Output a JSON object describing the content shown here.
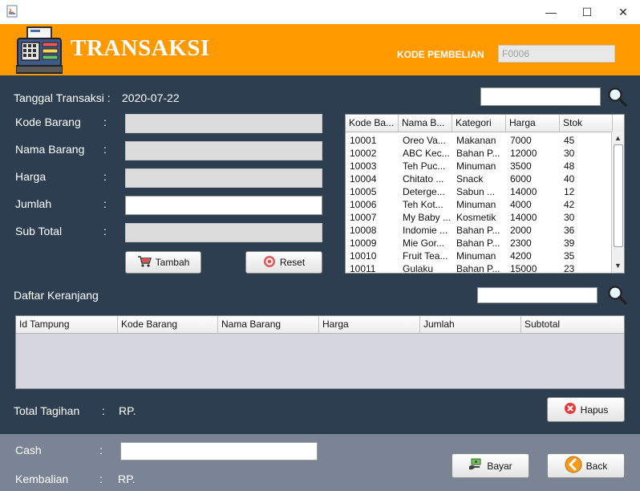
{
  "window": {
    "minimize": "—",
    "maximize": "☐",
    "close": "✕"
  },
  "header": {
    "title": "TRANSAKSI",
    "kode_label": "KODE PEMBELIAN",
    "kode_value": "F0006"
  },
  "form": {
    "tanggal_label": "Tanggal Transaksi :",
    "tanggal_value": "2020-07-22",
    "kode_label": "Kode Barang",
    "nama_label": "Nama Barang",
    "harga_label": "Harga",
    "jumlah_label": "Jumlah",
    "subtotal_label": "Sub Total",
    "colon": ":",
    "tambah": "Tambah",
    "reset": "Reset"
  },
  "barang_table": {
    "headers": [
      "Kode Ba...",
      "Nama B...",
      "Kategori",
      "Harga",
      "Stok"
    ],
    "rows": [
      [
        "10001",
        "Oreo Va...",
        "Makanan",
        "7000",
        "45"
      ],
      [
        "10002",
        "ABC Kec...",
        "Bahan P...",
        "12000",
        "30"
      ],
      [
        "10003",
        "Teh Puc...",
        "Minuman",
        "3500",
        "48"
      ],
      [
        "10004",
        "Chitato ...",
        "Snack",
        "6000",
        "40"
      ],
      [
        "10005",
        "Deterge...",
        "Sabun ...",
        "14000",
        "12"
      ],
      [
        "10006",
        "Teh Kot...",
        "Minuman",
        "4000",
        "42"
      ],
      [
        "10007",
        "My Baby ...",
        "Kosmetik",
        "14000",
        "30"
      ],
      [
        "10008",
        "Indomie ...",
        "Bahan P...",
        "2000",
        "36"
      ],
      [
        "10009",
        "Mie Gor...",
        "Bahan P...",
        "2300",
        "39"
      ],
      [
        "10010",
        "Fruit Tea...",
        "Minuman",
        "4200",
        "35"
      ],
      [
        "10011",
        "Gulaku",
        "Bahan P...",
        "15000",
        "23"
      ]
    ]
  },
  "keranjang": {
    "label": "Daftar Keranjang",
    "headers": [
      "Id Tampung",
      "Kode Barang",
      "Nama Barang",
      "Harga",
      "Jumlah",
      "Subtotal"
    ]
  },
  "total": {
    "label": "Total Tagihan",
    "colon": ":",
    "value": "RP.",
    "hapus": "Hapus"
  },
  "payment": {
    "cash_label": "Cash",
    "colon": ":",
    "kembalian_label": "Kembalian",
    "kembalian_value": "RP.",
    "bayar": "Bayar",
    "back": "Back"
  }
}
